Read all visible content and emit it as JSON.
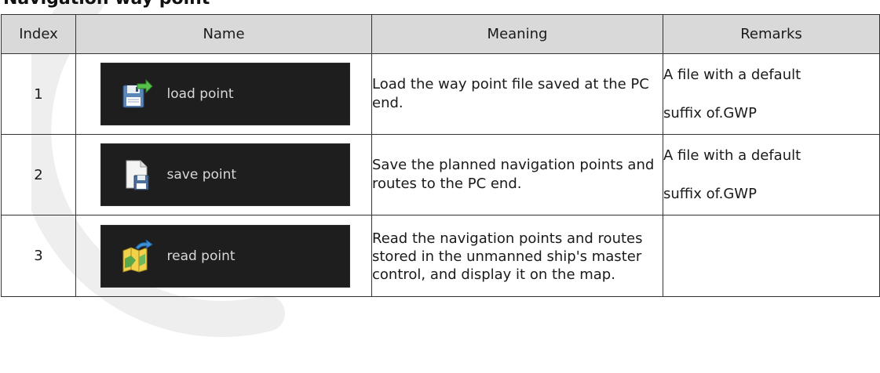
{
  "heading": "Navigation way point",
  "table": {
    "headers": [
      "Index",
      "Name",
      "Meaning",
      "Remarks"
    ],
    "rows": [
      {
        "index": "1",
        "button_label": "load point",
        "button_icon": "load-floppy-arrow-icon",
        "meaning": "Load the way point file saved at the PC end.",
        "remarks_line1": "A file with a default",
        "remarks_line2": "suffix of.GWP"
      },
      {
        "index": "2",
        "button_label": "save point",
        "button_icon": "save-document-disk-icon",
        "meaning": "Save the planned navigation points and routes to the PC end.",
        "remarks_line1": "A file with a default",
        "remarks_line2": "suffix of.GWP"
      },
      {
        "index": "3",
        "button_label": "read point",
        "button_icon": "read-map-arrow-icon",
        "meaning": "Read the navigation points and routes stored in the unmanned ship's master control, and display it on the map.",
        "remarks_line1": "",
        "remarks_line2": ""
      }
    ]
  },
  "colors": {
    "header_bg": "#d9d9d9",
    "button_bg": "#1e1e1e",
    "button_text": "#d8d8d8",
    "border": "#333333"
  }
}
